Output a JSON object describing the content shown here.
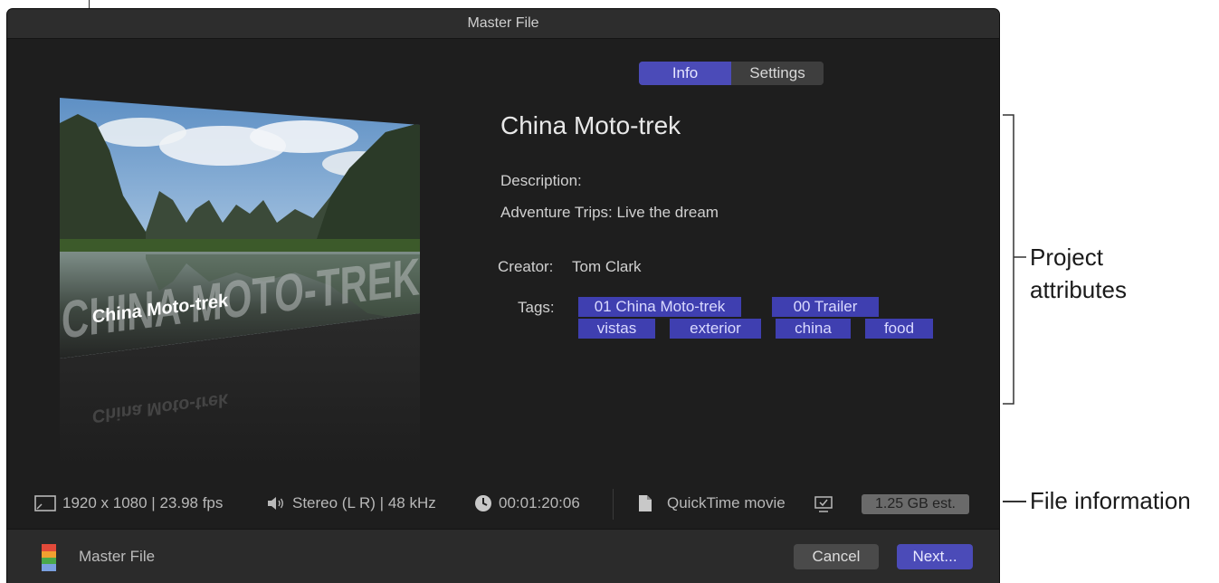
{
  "window": {
    "title": "Master File"
  },
  "tabs": [
    {
      "label": "Info",
      "selected": true
    },
    {
      "label": "Settings",
      "selected": false
    }
  ],
  "project": {
    "title": "China Moto-trek",
    "description_label": "Description:",
    "description": "Adventure Trips: Live the dream",
    "creator_label": "Creator:",
    "creator": "Tom Clark",
    "tags_label": "Tags:",
    "tags": [
      "01 China Moto-trek",
      "00 Trailer",
      "vistas",
      "exterior",
      "china",
      "food"
    ]
  },
  "thumbnail": {
    "big_text": "CHINA MOTO-TREK",
    "small_text": "China Moto-trek"
  },
  "file_info": {
    "video": "1920 x 1080 | 23.98 fps",
    "audio": "Stereo (L R) | 48 kHz",
    "duration": "00:01:20:06",
    "format": "QuickTime movie",
    "size": "1.25 GB est."
  },
  "footer": {
    "destination": "Master File",
    "cancel_label": "Cancel",
    "next_label": "Next..."
  },
  "annotations": {
    "project_attributes": [
      "Project",
      "attributes"
    ],
    "file_information": "File information"
  },
  "colors": {
    "accent": "#4b4bb8",
    "tag_bg": "#3f3fb0",
    "dialog_bg": "#1e1e1e"
  }
}
